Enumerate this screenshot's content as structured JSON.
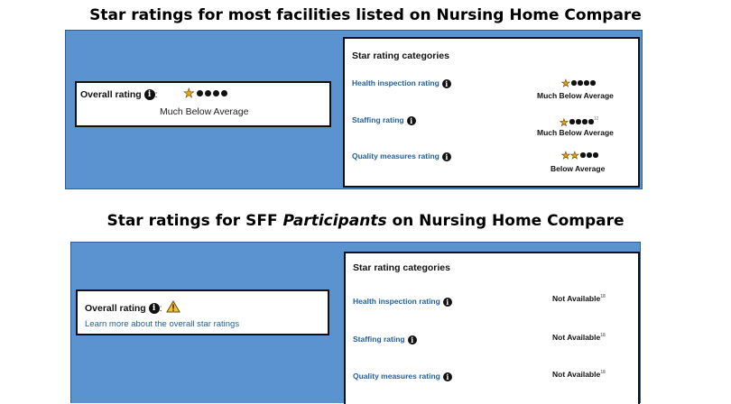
{
  "top": {
    "title": "Star ratings for most facilities listed on Nursing Home Compare",
    "overall": {
      "label": "Overall rating",
      "colon": ":",
      "icon": "info-icon",
      "star_rating": 1,
      "max_stars": 5,
      "rating_text": "Much Below Average"
    },
    "categories_heading": "Star rating categories",
    "categories": [
      {
        "label": "Health inspection rating",
        "icon": "info-icon",
        "star_rating": 1,
        "max_stars": 5,
        "sup": "",
        "rating_text": "Much Below Average"
      },
      {
        "label": "Staffing rating",
        "icon": "info-icon",
        "star_rating": 1,
        "max_stars": 5,
        "sup": "12",
        "rating_text": "Much Below Average"
      },
      {
        "label": "Quality measures rating",
        "icon": "info-icon",
        "star_rating": 2,
        "max_stars": 5,
        "sup": "",
        "rating_text": "Below Average"
      }
    ]
  },
  "bottom": {
    "title_prefix": "Star ratings for SFF ",
    "title_italic": "Participants",
    "title_suffix": " on Nursing Home Compare",
    "overall": {
      "label": "Overall rating",
      "colon": ":",
      "icon": "info-icon",
      "warning_icon": "warning-icon",
      "link": "Learn more about the overall star ratings"
    },
    "categories_heading": "Star rating categories",
    "categories": [
      {
        "label": "Health inspection rating",
        "icon": "info-icon",
        "value": "Not Available",
        "sup": "18"
      },
      {
        "label": "Staffing rating",
        "icon": "info-icon",
        "value": "Not Available",
        "sup": "18"
      },
      {
        "label": "Quality measures rating",
        "icon": "info-icon",
        "value": "Not Available",
        "sup": "18"
      }
    ]
  },
  "colors": {
    "panel_blue": "#5a93d0",
    "link_blue": "#1f5f9e",
    "star_gold": "#e8a317",
    "warning_yellow": "#f2c230"
  }
}
